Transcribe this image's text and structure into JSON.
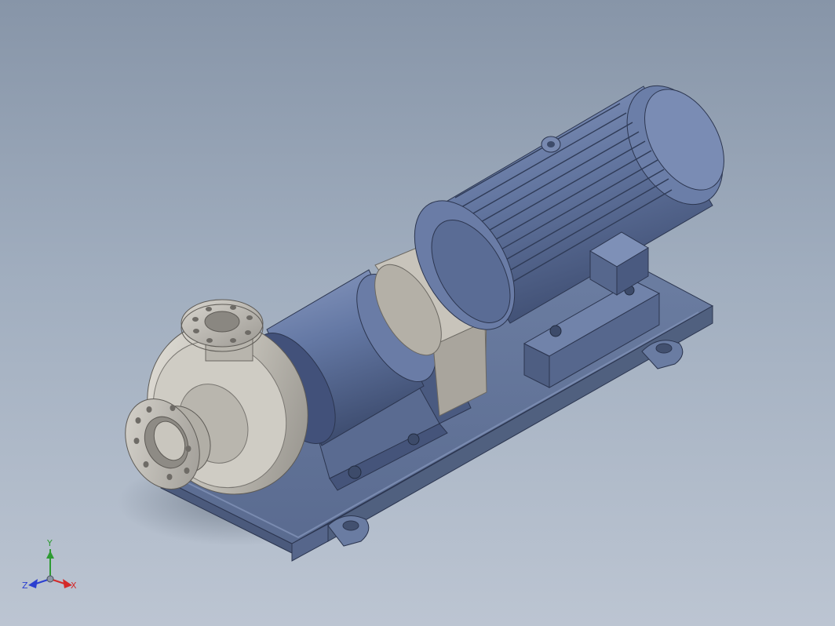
{
  "viewport": {
    "background_top": "#8795a8",
    "background_bottom": "#bcc5d2"
  },
  "model": {
    "body_color": "#5c6e94",
    "casing_color": "#c3c0b8",
    "motor_color": "#6276a0"
  },
  "triad": {
    "x_label": "X",
    "y_label": "Y",
    "z_label": "Z",
    "x_color": "#d42a2a",
    "y_color": "#2e9a33",
    "z_color": "#2b3fd0"
  }
}
